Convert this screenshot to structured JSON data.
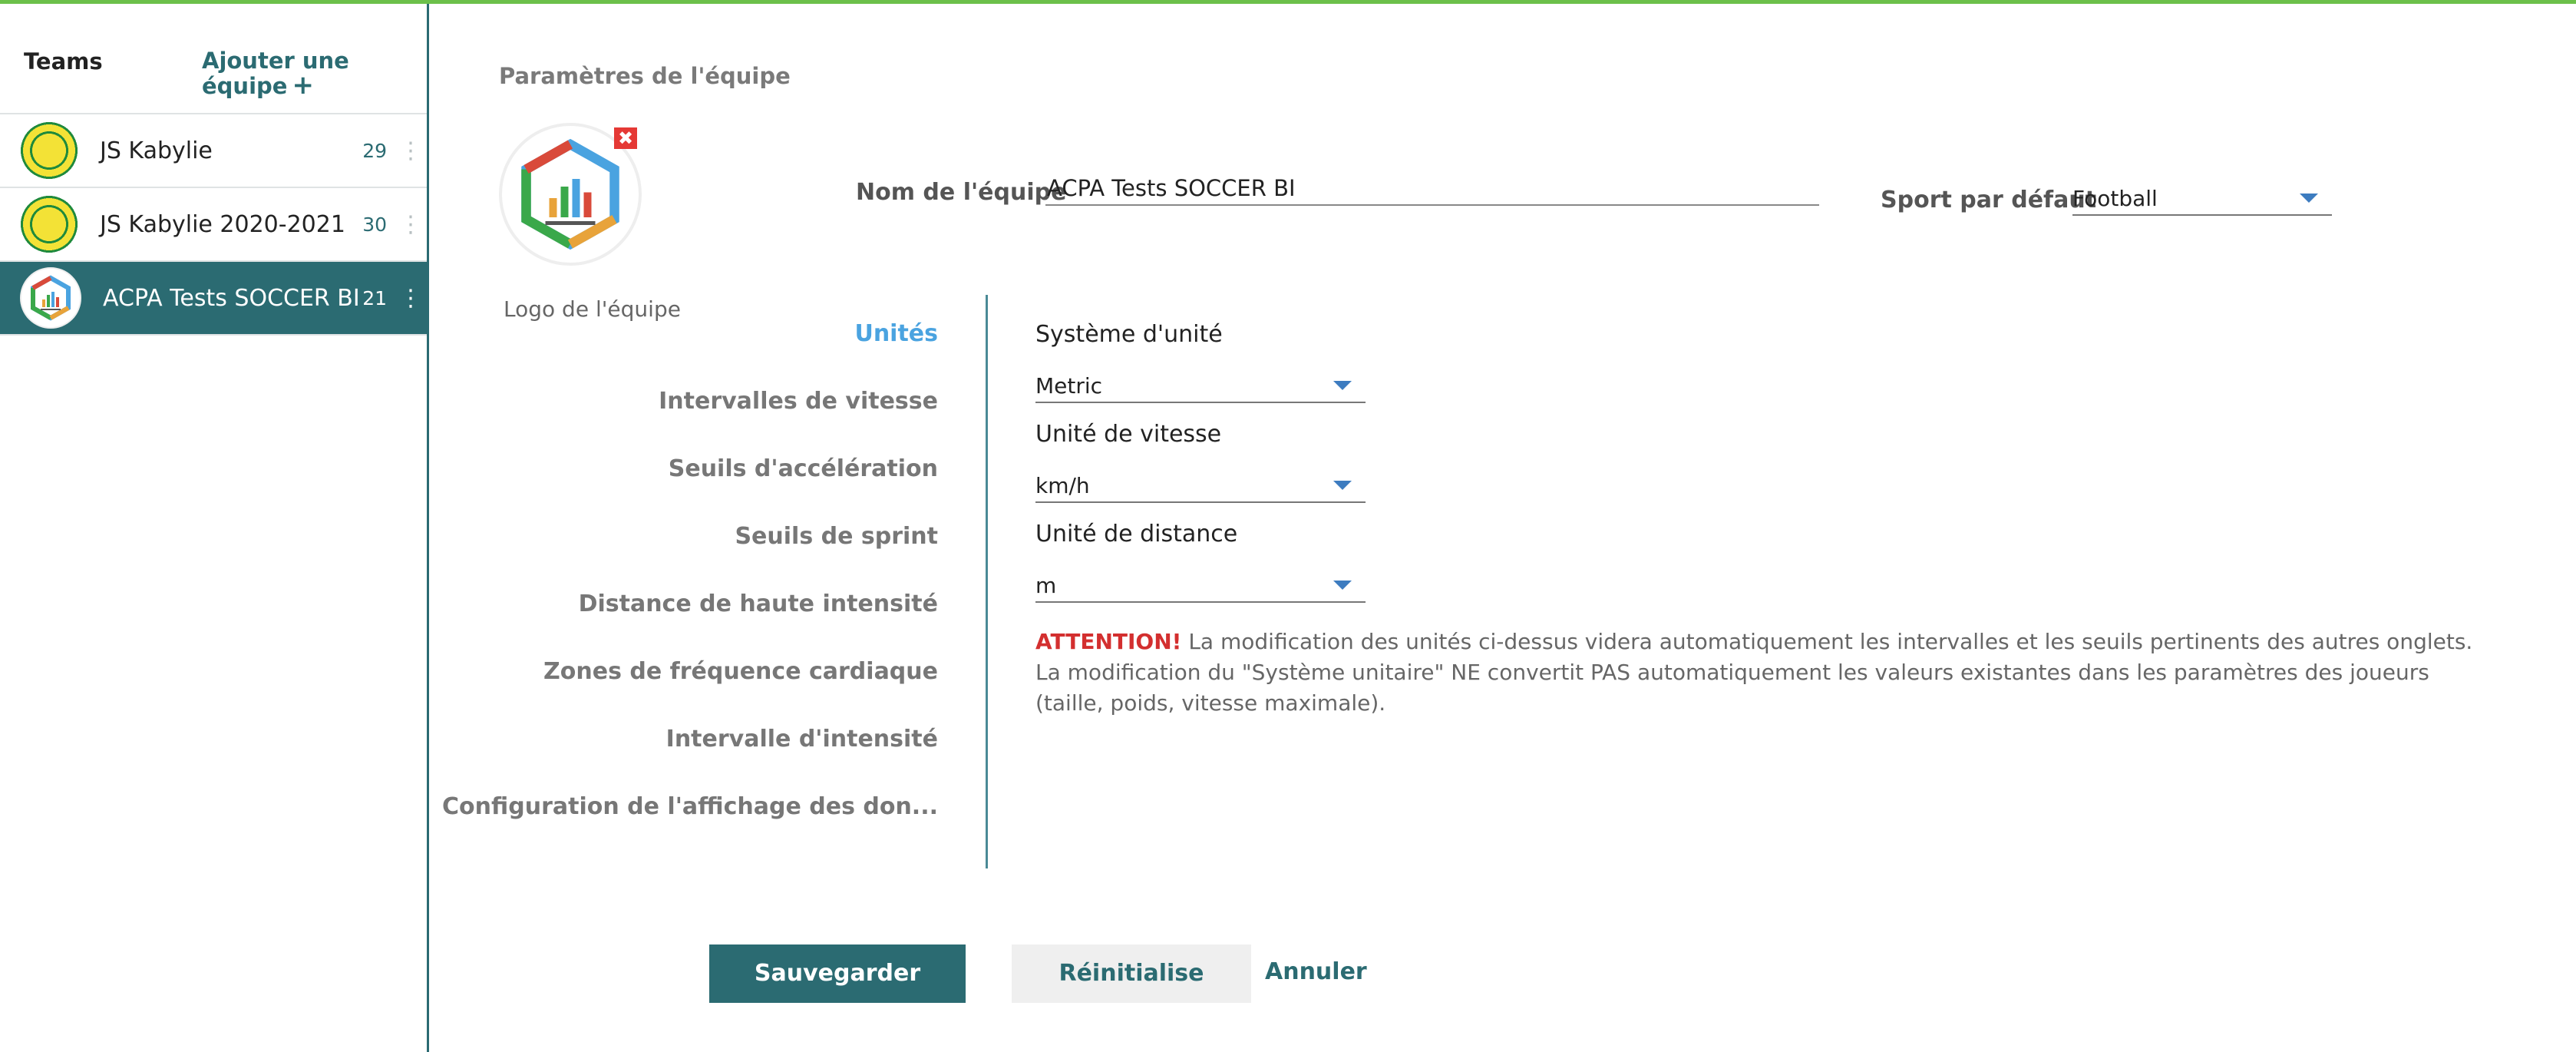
{
  "sidebar": {
    "heading": "Teams",
    "add_team_label": "Ajouter une équipe",
    "add_icon": "+",
    "teams": [
      {
        "name": "JS Kabylie",
        "count": "29",
        "logo": "jsk-logo"
      },
      {
        "name": "JS Kabylie 2020-2021",
        "count": "30",
        "logo": "jsk-logo"
      },
      {
        "name": "ACPA Tests SOCCER BI",
        "count": "21",
        "logo": "acpa-logo",
        "active": true
      }
    ],
    "menu_icon": "⋮"
  },
  "main": {
    "title": "Paramètres de l'équipe",
    "logo_label": "Logo de l'équipe",
    "remove_icon": "✖",
    "team_name_label": "Nom de l'équipe",
    "team_name_value": "ACPA Tests SOCCER BI",
    "default_sport_label": "Sport par défaut",
    "default_sport_value": "Football"
  },
  "tabs": [
    {
      "label": "Unités",
      "active": true
    },
    {
      "label": "Intervalles de vitesse"
    },
    {
      "label": "Seuils d'accélération"
    },
    {
      "label": "Seuils de sprint"
    },
    {
      "label": "Distance de haute intensité"
    },
    {
      "label": "Zones de fréquence cardiaque"
    },
    {
      "label": "Intervalle d'intensité"
    },
    {
      "label": "Configuration de l'affichage des don..."
    }
  ],
  "units": {
    "system_label": "Système d'unité",
    "system_value": "Metric",
    "speed_label": "Unité de vitesse",
    "speed_value": "km/h",
    "distance_label": "Unité de distance",
    "distance_value": "m",
    "warning_attn": "ATTENTION!",
    "warning_line1": " La modification des unités ci-dessus videra automatiquement les intervalles et les seuils pertinents des autres onglets.",
    "warning_line2": "La modification du \"Système unitaire\" NE convertit PAS automatiquement les valeurs existantes dans les paramètres des joueurs (taille, poids, vitesse maximale)."
  },
  "actions": {
    "save": "Sauvegarder",
    "reset": "Réinitialise",
    "cancel": "Annuler"
  },
  "colors": {
    "accent": "#2b6b72",
    "active_tab": "#4aa3e0",
    "warning": "#d32f2f",
    "top_bar": "#6cc04a"
  }
}
